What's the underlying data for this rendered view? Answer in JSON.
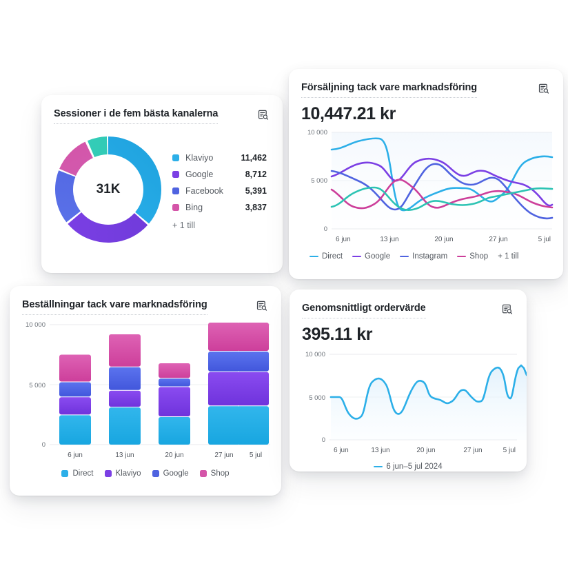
{
  "cards": {
    "sessions": {
      "title": "Sessioner i de fem bästa kanalerna",
      "icon": "report-search-icon",
      "center_total": "31K",
      "more_label": "+ 1 till"
    },
    "sales": {
      "title": "Försäljning tack vare marknadsföring",
      "icon": "report-search-icon",
      "value": "10,447.21 kr",
      "more_label": "+ 1 till"
    },
    "orders": {
      "title": "Beställningar tack vare marknadsföring",
      "icon": "report-search-icon"
    },
    "aov": {
      "title": "Genomsnittligt ordervärde",
      "icon": "report-search-icon",
      "value": "395.11 kr"
    }
  },
  "colors": {
    "cyan": "#2CAFE8",
    "violet": "#7B3FE4",
    "royal": "#4F63E0",
    "pink": "#D455A8",
    "teal": "#2BC3B3",
    "magenta": "#CC3E9A",
    "grid": "#e8eaed",
    "axis_text": "#6b7178"
  },
  "chart_data": [
    {
      "id": "sessions-donut",
      "type": "pie",
      "title": "Sessioner i de fem bästa kanalerna",
      "center_label": "31K",
      "legend_position": "right",
      "categories": [
        "Klaviyo",
        "Google",
        "Facebook",
        "Bing",
        "+ 1 till"
      ],
      "values": [
        11462,
        8712,
        5391,
        3837,
        1900
      ],
      "value_labels": [
        "11,462",
        "8,712",
        "5,391",
        "3,837",
        ""
      ],
      "colors": [
        "#2CAFE8",
        "#7B3FE4",
        "#4F63E0",
        "#D455A8",
        "#2BC3B3"
      ],
      "visible_legend_rows": 4,
      "hidden_count_label": "+ 1 till"
    },
    {
      "id": "sales-lines",
      "type": "line",
      "title": "Försäljning tack vare marknadsföring",
      "headline_value": "10,447.21 kr",
      "xlabel": "",
      "ylabel": "",
      "ylim": [
        0,
        10000
      ],
      "yticks": [
        0,
        5000,
        10000
      ],
      "ytick_labels": [
        "0",
        "5 000",
        "10 000"
      ],
      "x": [
        "6 jun",
        "13 jun",
        "20 jun",
        "27 jun",
        "5 jul"
      ],
      "xtick_labels": [
        "6 jun",
        "13 jun",
        "20 jun",
        "27 jun",
        "5 jul"
      ],
      "grid": true,
      "legend_position": "bottom",
      "legend_more": "+ 1 till",
      "series": [
        {
          "name": "Direct",
          "color": "#2CAFE8",
          "values": [
            8200,
            8400,
            9300,
            9200,
            2100,
            1900,
            2600,
            3400,
            3600,
            4200,
            4100,
            3000,
            4400,
            7200,
            7400
          ]
        },
        {
          "name": "Google",
          "color": "#7B3FE4",
          "values": [
            5400,
            6600,
            7000,
            5100,
            5700,
            6900,
            7100,
            5900,
            5600,
            5500,
            5700,
            5000,
            4600,
            4200,
            2500
          ]
        },
        {
          "name": "Instagram",
          "color": "#4F63E0",
          "values": [
            6000,
            5400,
            4900,
            2600,
            2000,
            2500,
            5900,
            6600,
            5300,
            6000,
            5100,
            4400,
            2400,
            1500,
            1200
          ]
        },
        {
          "name": "Shop",
          "color": "#CC3E9A",
          "values": [
            4100,
            2400,
            1900,
            2500,
            4300,
            4900,
            3600,
            2200,
            2600,
            2900,
            3200,
            3500,
            3800,
            3100,
            2300
          ]
        },
        {
          "name": "+ 1 till",
          "color": "#2BC3B3",
          "values": [
            2300,
            3400,
            4200,
            3800,
            2100,
            1900,
            2300,
            2800,
            2500,
            2300,
            2700,
            3000,
            3400,
            4000,
            4100
          ]
        }
      ]
    },
    {
      "id": "orders-bars",
      "type": "bar",
      "title": "Beställningar tack vare marknadsföring",
      "stacked": true,
      "xlabel": "",
      "ylabel": "",
      "ylim": [
        0,
        10000
      ],
      "yticks": [
        0,
        5000,
        10000
      ],
      "ytick_labels": [
        "0",
        "5 000",
        "10 000"
      ],
      "categories": [
        "6 jun",
        "13 jun",
        "20 jun",
        "27 jun",
        "5 jul"
      ],
      "grid": true,
      "legend_position": "bottom",
      "series": [
        {
          "name": "Direct",
          "color": "#2CAFE8",
          "values": [
            2450,
            3100,
            2300,
            3200,
            3200
          ]
        },
        {
          "name": "Klaviyo",
          "color": "#7B3FE4",
          "values": [
            1500,
            1400,
            2500,
            2850,
            2850
          ]
        },
        {
          "name": "Google",
          "color": "#4F63E0",
          "values": [
            1250,
            1950,
            700,
            1650,
            1650
          ]
        },
        {
          "name": "Shop",
          "color": "#D455A8",
          "values": [
            2250,
            2750,
            1250,
            2350,
            2350
          ]
        }
      ],
      "totals": [
        7450,
        9200,
        6750,
        10050,
        10050
      ]
    },
    {
      "id": "aov-line",
      "type": "area",
      "title": "Genomsnittligt ordervärde",
      "headline_value": "395.11 kr",
      "xlabel": "",
      "ylabel": "",
      "ylim": [
        0,
        10000
      ],
      "yticks": [
        0,
        5000,
        10000
      ],
      "ytick_labels": [
        "0",
        "5 000",
        "10 000"
      ],
      "xtick_labels": [
        "6 jun",
        "13 jun",
        "20 jun",
        "27 jun",
        "5 jul"
      ],
      "grid": true,
      "legend_position": "bottom",
      "series": [
        {
          "name": "6 jun–5 jul 2024",
          "color": "#2CAFE8",
          "values": [
            5100,
            5150,
            3300,
            3100,
            6600,
            6900,
            4000,
            3700,
            6900,
            7100,
            6100,
            5900,
            4800,
            4600,
            5900,
            6100,
            5400,
            5200,
            4900,
            8000,
            8300,
            5300,
            5100,
            8500,
            8700,
            7600,
            7500,
            7550
          ]
        }
      ]
    }
  ]
}
